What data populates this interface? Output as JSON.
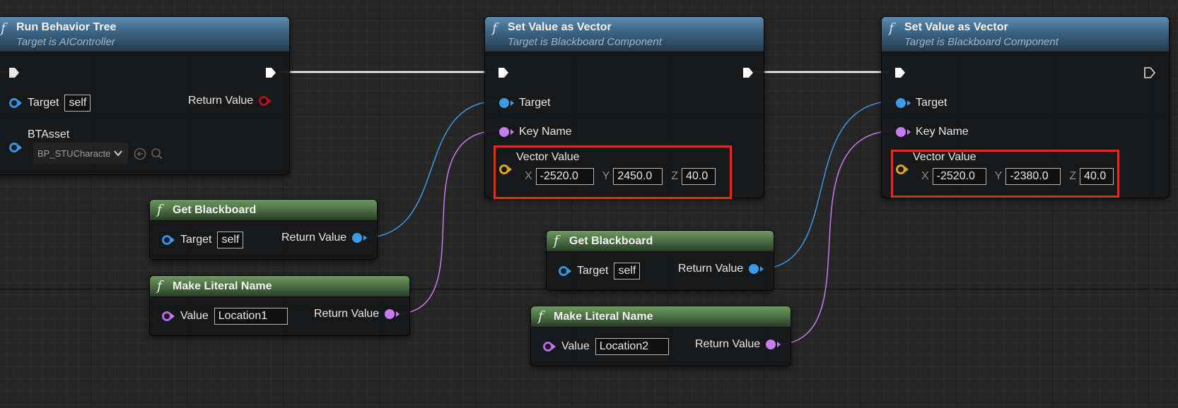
{
  "nodes": {
    "run_bt": {
      "title": "Run Behavior Tree",
      "subtitle": "Target is AIController",
      "target_label": "Target",
      "target_value": "self",
      "return_label": "Return Value",
      "btasset_label": "BTAsset",
      "btasset_value": "BP_STUCharacte"
    },
    "set_vec_1": {
      "title": "Set Value as Vector",
      "subtitle": "Target is Blackboard Component",
      "target_label": "Target",
      "key_label": "Key Name",
      "vector_label": "Vector Value",
      "x_label": "X",
      "x": "-2520.0",
      "y_label": "Y",
      "y": "2450.0",
      "z_label": "Z",
      "z": "40.0"
    },
    "set_vec_2": {
      "title": "Set Value as Vector",
      "subtitle": "Target is Blackboard Component",
      "target_label": "Target",
      "key_label": "Key Name",
      "vector_label": "Vector Value",
      "x_label": "X",
      "x": "-2520.0",
      "y_label": "Y",
      "y": "-2380.0",
      "z_label": "Z",
      "z": "40.0"
    },
    "get_bb_1": {
      "title": "Get Blackboard",
      "target_label": "Target",
      "target_value": "self",
      "return_label": "Return Value"
    },
    "get_bb_2": {
      "title": "Get Blackboard",
      "target_label": "Target",
      "target_value": "self",
      "return_label": "Return Value"
    },
    "lit_name_1": {
      "title": "Make Literal Name",
      "value_label": "Value",
      "value": "Location1",
      "return_label": "Return Value"
    },
    "lit_name_2": {
      "title": "Make Literal Name",
      "value_label": "Value",
      "value": "Location2",
      "return_label": "Return Value"
    }
  },
  "icons": {
    "function": "f",
    "exec_pin": "exec-pin-icon",
    "browse": "browse-arrow-icon",
    "search": "search-icon"
  },
  "colors": {
    "object_pin": "#3c9be8",
    "name_pin": "#c47cf0",
    "vector_pin": "#d7a520",
    "return_object_pin": "#a8181a",
    "highlight_box": "#d8321c",
    "exec_wire": "#ffffff"
  }
}
